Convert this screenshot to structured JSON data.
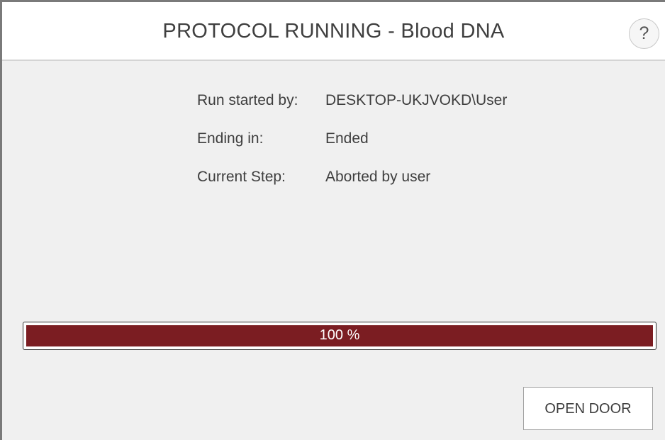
{
  "header": {
    "title": "PROTOCOL RUNNING - Blood DNA",
    "help_label": "?",
    "help_icon": "question-mark-icon"
  },
  "info": {
    "rows": [
      {
        "label": "Run started by:",
        "value": "DESKTOP-UKJVOKD\\User"
      },
      {
        "label": "Ending in:",
        "value": "Ended"
      },
      {
        "label": "Current Step:",
        "value": "Aborted by user"
      }
    ]
  },
  "progress": {
    "percent": 100,
    "label": "100 %",
    "fill_color": "#7b1d22"
  },
  "actions": {
    "open_door_label": "OPEN DOOR"
  }
}
